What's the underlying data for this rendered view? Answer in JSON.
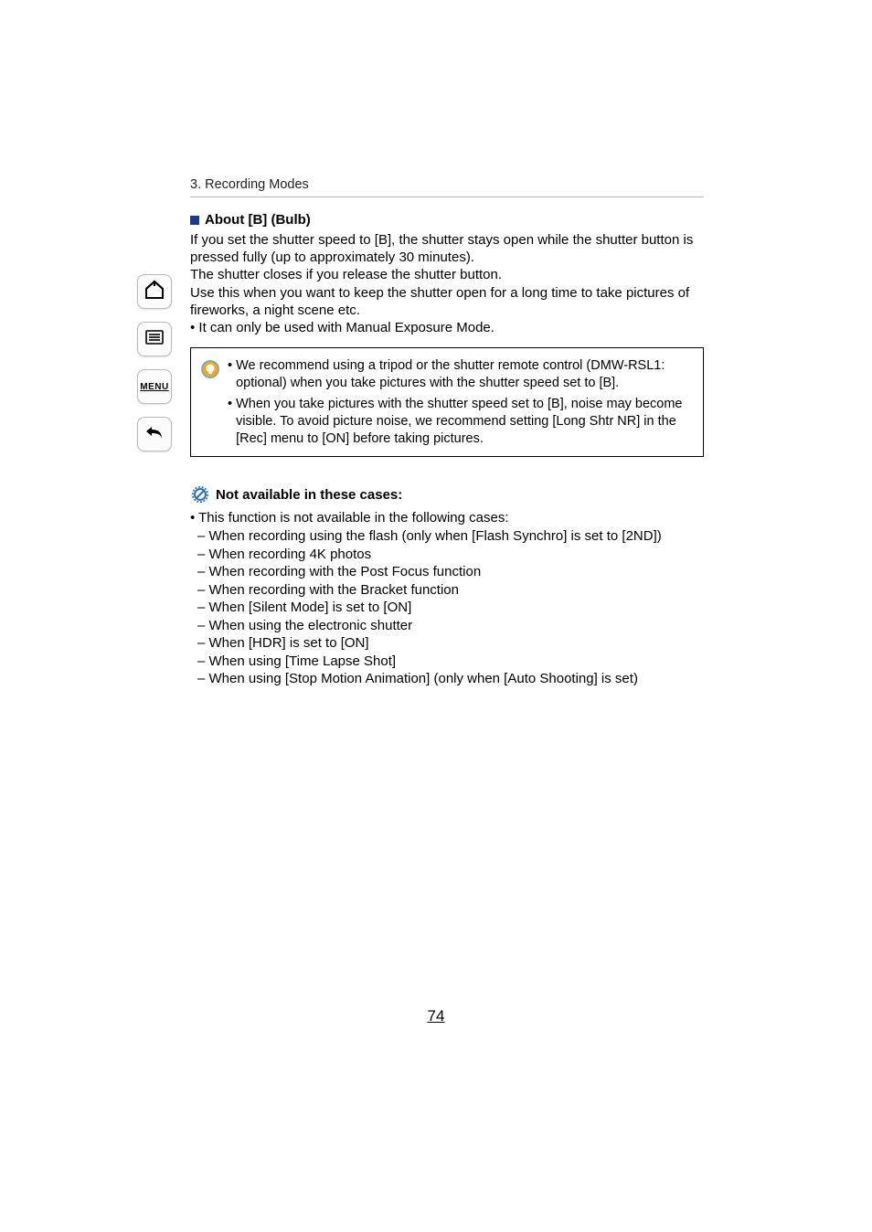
{
  "sidebar": {
    "menu_label": "MENU"
  },
  "section": {
    "label": "3. Recording Modes"
  },
  "heading": "About [B] (Bulb)",
  "body": {
    "l1": "If you set the shutter speed to [B], the shutter stays open while the shutter button is",
    "l2": "pressed fully (up to approximately 30 minutes).",
    "l3": "The shutter closes if you release the shutter button.",
    "l4": "Use this when you want to keep the shutter open for a long time to take pictures of",
    "l5": "fireworks, a night scene etc.",
    "l6": "• It can only be used with Manual Exposure Mode."
  },
  "tips": {
    "t1": "We recommend using a tripod or the shutter remote control (DMW-RSL1: optional) when you take pictures with the shutter speed set to [B].",
    "t2": "When you take pictures with the shutter speed set to [B], noise may become visible. To avoid picture noise, we recommend setting [Long Shtr NR] in the [Rec] menu to [ON] before taking pictures."
  },
  "notavail": {
    "title": "Not available in these cases:",
    "lead": "• This function is not available in the following cases:",
    "items": [
      "– When recording using the flash (only when [Flash Synchro] is set to [2ND])",
      "– When recording 4K photos",
      "– When recording with the Post Focus function",
      "– When recording with the Bracket function",
      "– When [Silent Mode] is set to [ON]",
      "– When using the electronic shutter",
      "– When [HDR] is set to [ON]",
      "– When using [Time Lapse Shot]",
      "– When using [Stop Motion Animation] (only when [Auto Shooting] is set)"
    ]
  },
  "page_number": "74"
}
